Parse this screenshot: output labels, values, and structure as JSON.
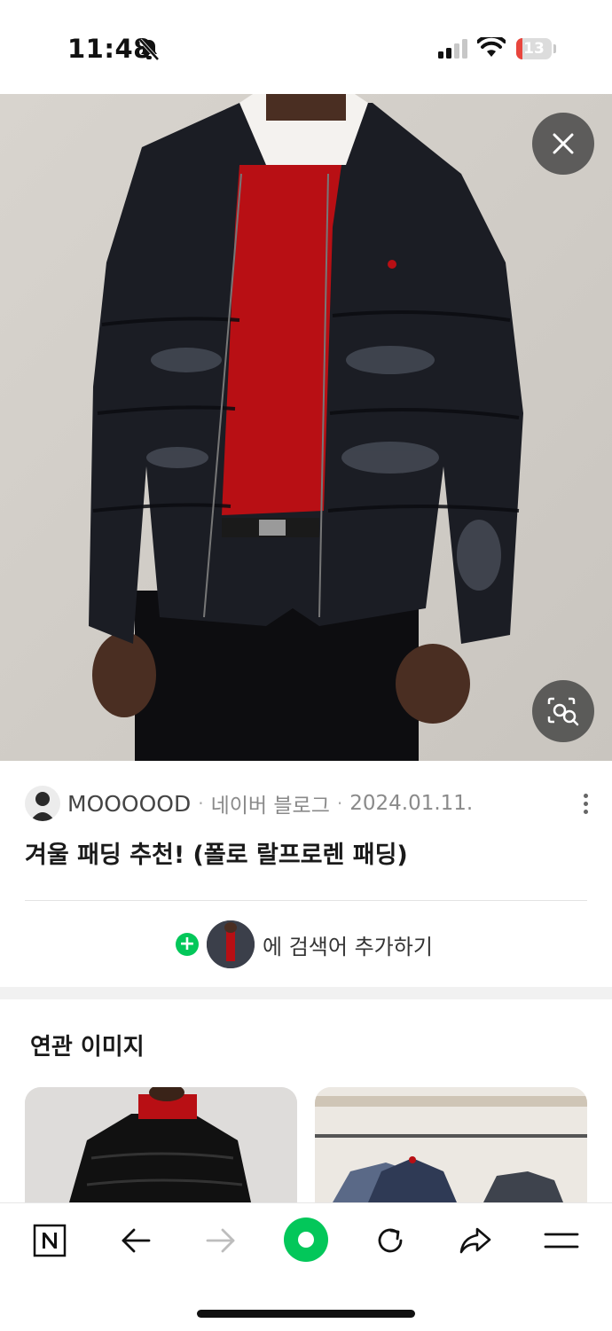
{
  "status": {
    "time": "11:48",
    "battery": "13",
    "icons": [
      "bell-muted-icon",
      "signal-icon",
      "wifi-icon",
      "battery-icon"
    ]
  },
  "image_viewer": {
    "close_icon": "close-icon",
    "lens_icon": "image-search-icon"
  },
  "post": {
    "author": "MOOOOOD",
    "source": "네이버 블로그",
    "date": "2024.01.11.",
    "title": "겨울 패딩 추천! (폴로 랄프로렌 패딩)",
    "more_icon": "more-vertical-icon"
  },
  "add_search": {
    "label": "에 검색어 추가하기"
  },
  "related": {
    "title": "연관 이미지"
  },
  "bottom_nav": {
    "items": [
      "naver-n-icon",
      "back-arrow-icon",
      "forward-arrow-icon",
      "green-dot-icon",
      "refresh-icon",
      "share-icon",
      "menu-icon"
    ],
    "accent": "#03c75a"
  }
}
